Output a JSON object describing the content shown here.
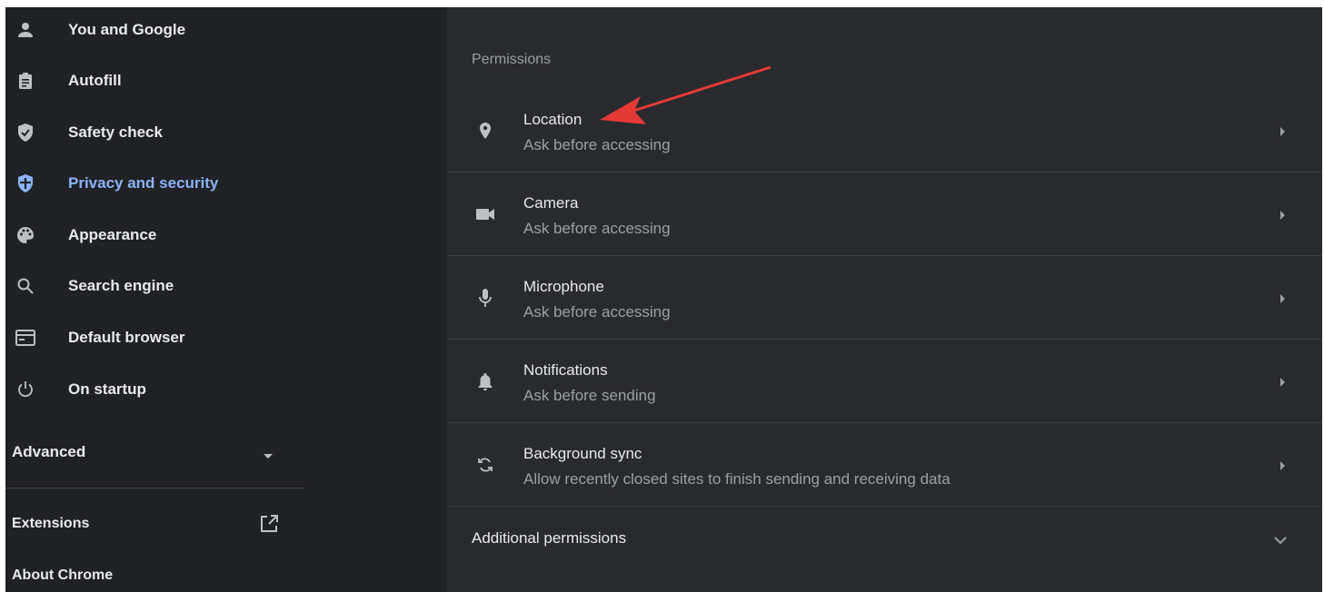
{
  "sidebar": {
    "items": [
      {
        "label": "You and Google",
        "icon": "person-icon"
      },
      {
        "label": "Autofill",
        "icon": "clipboard-icon"
      },
      {
        "label": "Safety check",
        "icon": "shield-check-icon"
      },
      {
        "label": "Privacy and security",
        "icon": "shield-lock-icon",
        "active": true
      },
      {
        "label": "Appearance",
        "icon": "palette-icon"
      },
      {
        "label": "Search engine",
        "icon": "search-icon"
      },
      {
        "label": "Default browser",
        "icon": "browser-window-icon"
      },
      {
        "label": "On startup",
        "icon": "power-icon"
      }
    ],
    "advanced_label": "Advanced",
    "extensions_label": "Extensions",
    "about_label": "About Chrome"
  },
  "main": {
    "section_title": "Permissions",
    "permissions": [
      {
        "title": "Location",
        "subtitle": "Ask before accessing",
        "icon": "location-pin-icon"
      },
      {
        "title": "Camera",
        "subtitle": "Ask before accessing",
        "icon": "camera-icon"
      },
      {
        "title": "Microphone",
        "subtitle": "Ask before accessing",
        "icon": "microphone-icon"
      },
      {
        "title": "Notifications",
        "subtitle": "Ask before sending",
        "icon": "bell-icon"
      },
      {
        "title": "Background sync",
        "subtitle": "Allow recently closed sites to finish sending and receiving data",
        "icon": "sync-icon"
      }
    ],
    "additional_label": "Additional permissions"
  },
  "colors": {
    "sidebar_bg": "#202124",
    "main_bg": "#292a2d",
    "text": "#e8eaed",
    "secondary_text": "#9aa0a6",
    "active": "#8ab4f8",
    "annotation_arrow": "#e53935"
  }
}
